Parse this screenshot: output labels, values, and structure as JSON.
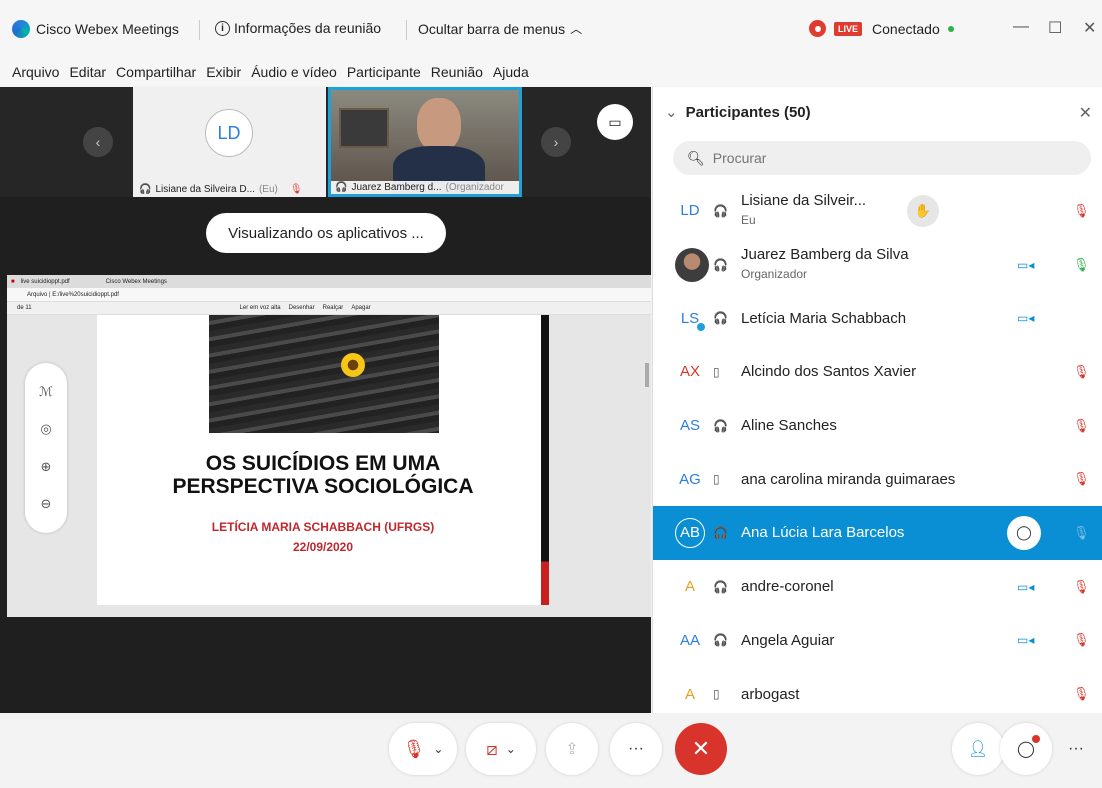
{
  "titlebar": {
    "app_name": "Cisco Webex Meetings",
    "meeting_info": "Informações da reunião",
    "hide_menu": "Ocultar barra de menus",
    "live_badge": "LIVE",
    "status": "Conectado"
  },
  "menu": [
    "Arquivo",
    "Editar",
    "Compartilhar",
    "Exibir",
    "Áudio e vídeo",
    "Participante",
    "Reunião",
    "Ajuda"
  ],
  "thumbnails": {
    "ld_initials": "LD",
    "ld_name": "Lisiane da Silveira D...",
    "ld_suffix": "(Eu)",
    "jz_name": "Juarez Bamberg d...",
    "jz_suffix": "(Organizador"
  },
  "viewing_label": "Visualizando os aplicativos ...",
  "shared_screen": {
    "tab1": "live suicidioppt.pdf",
    "tab2": "Cisco Webex Meetings",
    "url": "Arquivo | E:/live%20suicidioppt.pdf",
    "page_info": "de 11",
    "toolbar_read": "Ler em voz alta",
    "toolbar_draw": "Desenhar",
    "toolbar_highlight": "Realçar",
    "toolbar_erase": "Apagar",
    "slide_title_line1": "OS SUICÍDIOS EM UMA",
    "slide_title_line2": "PERSPECTIVA SOCIOLÓGICA",
    "slide_author": "LETÍCIA MARIA SCHABBACH (UFRGS)",
    "slide_date": "22/09/2020"
  },
  "panel": {
    "title": "Participantes (50)",
    "search_placeholder": "Procurar",
    "participants": [
      {
        "initials": "LD",
        "name": "Lisiane da Silveir...",
        "sub": "Eu",
        "color": "#2a7de1"
      },
      {
        "initials": "",
        "name": "Juarez Bamberg da Silva",
        "sub": "Organizador",
        "color": "#333333"
      },
      {
        "initials": "LS",
        "name": "Letícia Maria Schabbach",
        "sub": "",
        "color": "#2a7de1"
      },
      {
        "initials": "AX",
        "name": "Alcindo dos Santos Xavier",
        "sub": "",
        "color": "#d9342b"
      },
      {
        "initials": "AS",
        "name": "Aline Sanches",
        "sub": "",
        "color": "#2a7de1"
      },
      {
        "initials": "AG",
        "name": "ana carolina miranda guimaraes",
        "sub": "",
        "color": "#2a7de1"
      },
      {
        "initials": "AB",
        "name": "Ana Lúcia Lara Barcelos",
        "sub": "",
        "color": "#ffffff"
      },
      {
        "initials": "A",
        "name": "andre-coronel",
        "sub": "",
        "color": "#e6a020"
      },
      {
        "initials": "AA",
        "name": "Angela Aguiar",
        "sub": "",
        "color": "#2a7de1"
      },
      {
        "initials": "A",
        "name": "arbogast",
        "sub": "",
        "color": "#e6a020"
      }
    ]
  }
}
